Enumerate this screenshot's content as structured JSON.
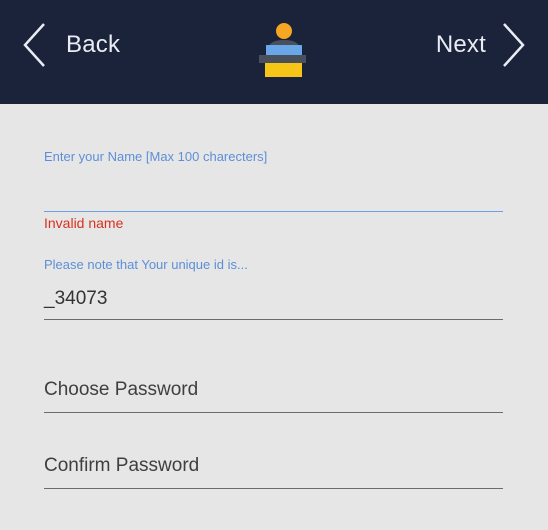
{
  "header": {
    "back_label": "Back",
    "next_label": "Next",
    "logo_icon": "user-at-laptop-icon",
    "colors": {
      "background": "#1a233a",
      "logo_head": "#f5a623",
      "logo_body": "#4a4f5c",
      "logo_screen": "#6aa7e8",
      "logo_base": "#f5c518"
    }
  },
  "form": {
    "name_field": {
      "caption": "Enter your Name [Max 100 charecters]",
      "value": "",
      "error": "Invalid name"
    },
    "unique_id": {
      "caption": "Please note that Your unique id is...",
      "value": "_34073"
    },
    "password": {
      "placeholder": "Choose Password",
      "value": ""
    },
    "confirm_password": {
      "placeholder": "Confirm Password",
      "value": ""
    },
    "colors": {
      "caption": "#5d8fd8",
      "error": "#d9311c",
      "background": "#e6e6e6"
    }
  }
}
